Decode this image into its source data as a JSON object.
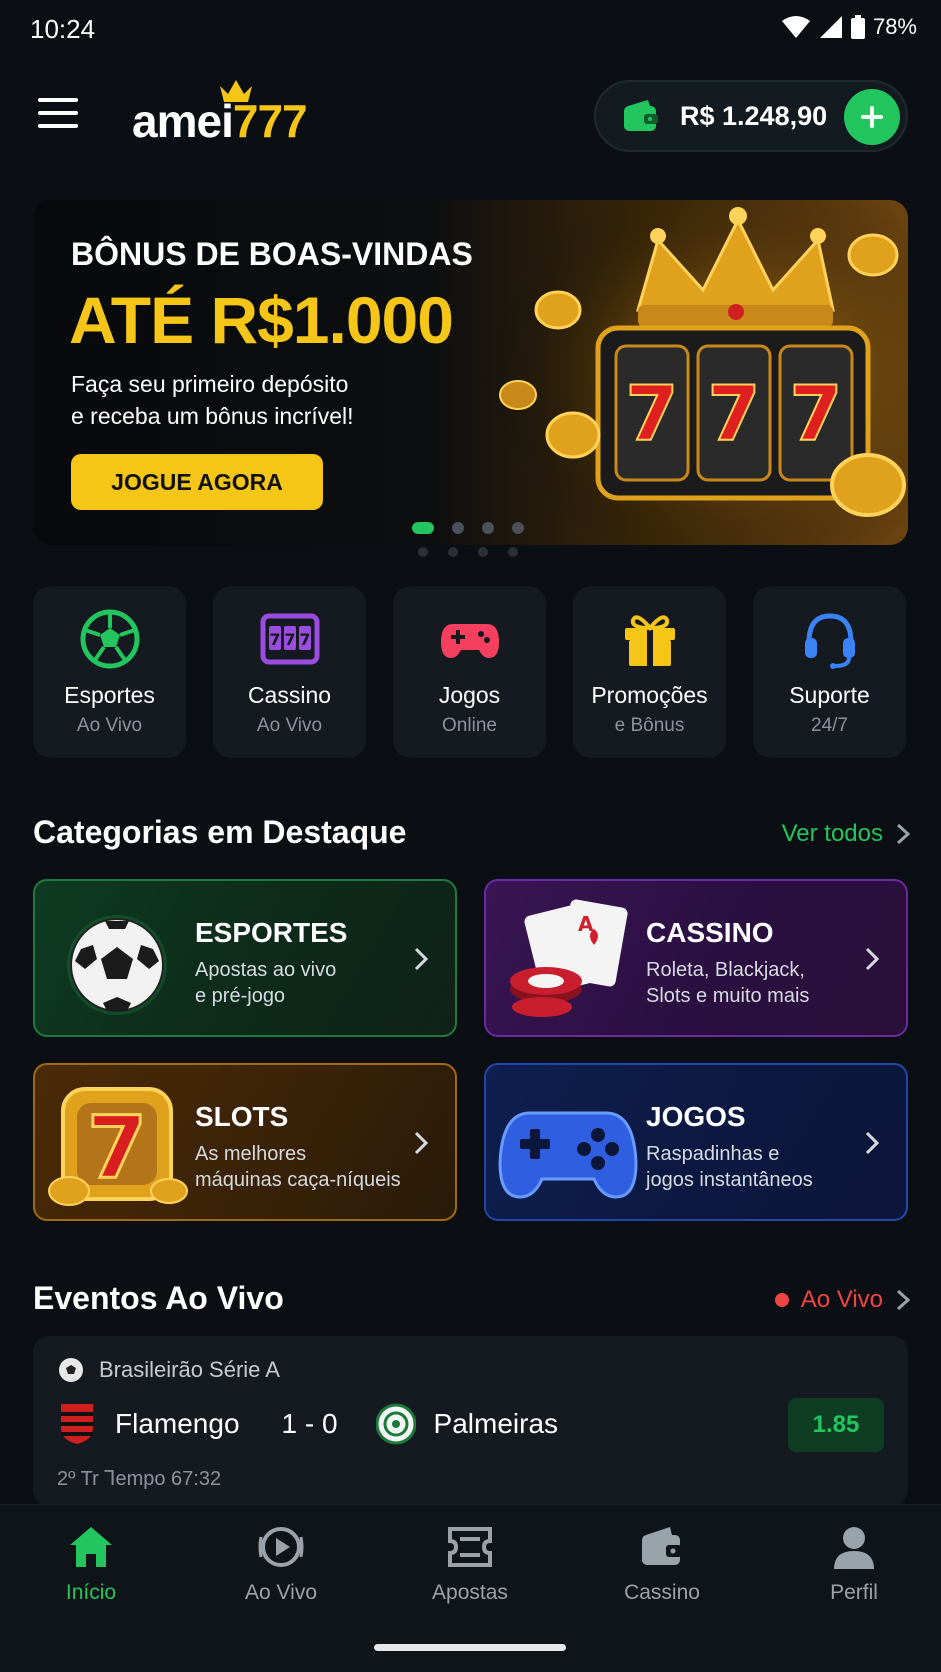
{
  "status_bar": {
    "time": "10:24",
    "battery": "78%"
  },
  "header": {
    "logo_part1": "amei",
    "logo_part2": "777",
    "balance": "R$ 1.248,90"
  },
  "banner": {
    "subtitle": "BÔNUS DE BOAS-VINDAS",
    "title": "ATÉ R$1.000",
    "desc_line1": "Faça seu primeiro depósito",
    "desc_line2": "e receba um bônus incrível!",
    "cta": "JOGUE AGORA",
    "slides": 4,
    "active_slide": 1
  },
  "quick_tiles": [
    {
      "title": "Esportes",
      "sub": "Ao Vivo",
      "icon": "soccer-ball-icon"
    },
    {
      "title": "Cassino",
      "sub": "Ao Vivo",
      "icon": "slot-machine-icon"
    },
    {
      "title": "Jogos",
      "sub": "Online",
      "icon": "gamepad-icon"
    },
    {
      "title": "Promoções",
      "sub": "e Bônus",
      "icon": "gift-icon"
    },
    {
      "title": "Suporte",
      "sub": "24/7",
      "icon": "headset-icon"
    }
  ],
  "featured": {
    "title": "Categorias em Destaque",
    "link": "Ver todos",
    "cards": [
      {
        "title": "ESPORTES",
        "line1": "Apostas ao vivo",
        "line2": "e pré-jogo"
      },
      {
        "title": "CASSINO",
        "line1": "Roleta, Blackjack,",
        "line2": "Slots e muito mais"
      },
      {
        "title": "SLOTS",
        "line1": "As melhores",
        "line2": "máquinas caça-níqueis"
      },
      {
        "title": "JOGOS",
        "line1": "Raspadinhas e",
        "line2": "jogos instantâneos"
      }
    ]
  },
  "live": {
    "title": "Eventos Ao Vivo",
    "link": "Ao Vivo",
    "event": {
      "league": "Brasileirão Série A",
      "home": "Flamengo",
      "score": "1 - 0",
      "away": "Palmeiras",
      "odds": "1.85",
      "time": "2º Tr  Ꞁempo  67:32"
    }
  },
  "bottom_nav": [
    {
      "label": "Início",
      "icon": "home-icon"
    },
    {
      "label": "Ao Vivo",
      "icon": "live-play-icon"
    },
    {
      "label": "Apostas",
      "icon": "ticket-icon"
    },
    {
      "label": "Cassino",
      "icon": "wallet-icon"
    },
    {
      "label": "Perfil",
      "icon": "user-icon"
    }
  ],
  "colors": {
    "accent": "#22c55e",
    "gold": "#f5c518",
    "live": "#ef4444",
    "bg": "#0b0f14"
  }
}
